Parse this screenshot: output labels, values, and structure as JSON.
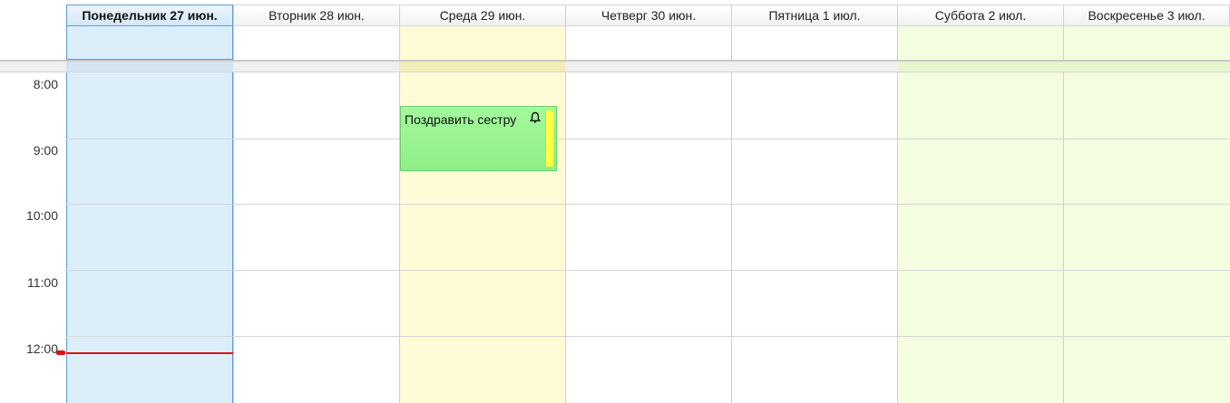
{
  "calendar": {
    "days": [
      {
        "label": "Понедельник 27 июн.",
        "today": true,
        "body_color": "#ddeefb",
        "allday_color": "#ddeefb",
        "sep_color": "#d3e4f3"
      },
      {
        "label": "Вторник 28 июн.",
        "today": false,
        "body_color": "#ffffff",
        "allday_color": "#ffffff",
        "sep_color": "#efefef"
      },
      {
        "label": "Среда 29 июн.",
        "today": false,
        "body_color": "#fffbd6",
        "allday_color": "#fffbd6",
        "sep_color": "#f2ecb8"
      },
      {
        "label": "Четверг 30 июн.",
        "today": false,
        "body_color": "#ffffff",
        "allday_color": "#ffffff",
        "sep_color": "#efefef"
      },
      {
        "label": "Пятница 1 июл.",
        "today": false,
        "body_color": "#ffffff",
        "allday_color": "#ffffff",
        "sep_color": "#efefef"
      },
      {
        "label": "Суббота 2 июл.",
        "today": false,
        "body_color": "#f4fde0",
        "allday_color": "#f4fde0",
        "sep_color": "#e9f5cf"
      },
      {
        "label": "Воскресенье 3 июл.",
        "today": false,
        "body_color": "#f4fde0",
        "allday_color": "#f4fde0",
        "sep_color": "#e9f5cf"
      }
    ],
    "time_labels": [
      "8:00",
      "9:00",
      "10:00",
      "11:00",
      "12:00"
    ],
    "event": {
      "title": "Поздравить сестру",
      "icon": "bell-icon",
      "has_reminder": true,
      "color": "#9cf494",
      "status_strip_color": "#ffff44"
    },
    "current_time_marker_color": "#e01010"
  }
}
